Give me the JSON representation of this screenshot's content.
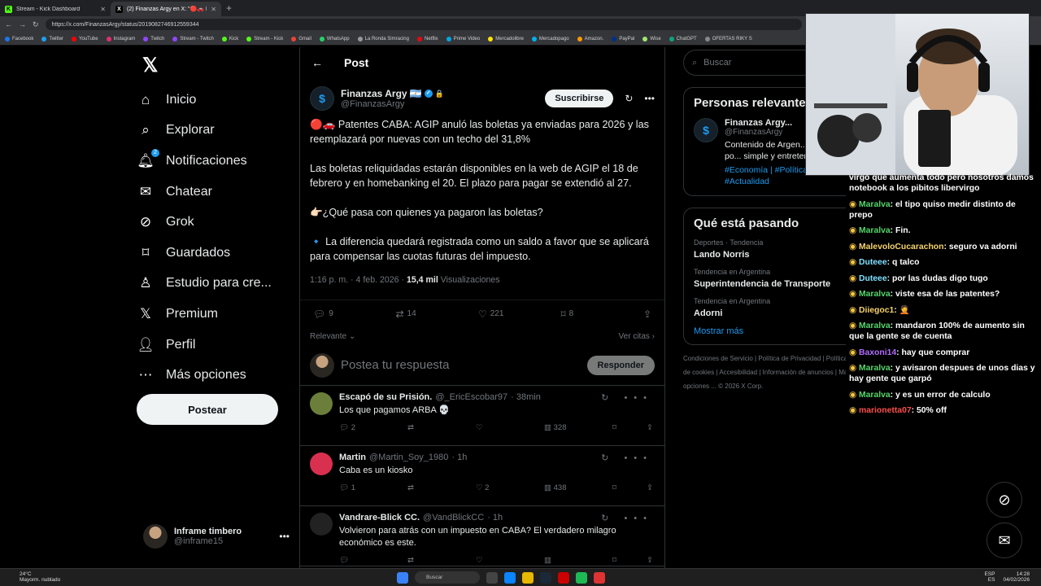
{
  "browser": {
    "tabs": [
      {
        "title": "Stream - Kick Dashboard",
        "icon": "K"
      },
      {
        "title": "(2) Finanzas Argy en X: \"🔴🚗 Pa...",
        "icon": "X"
      }
    ],
    "url": "https://x.com/FinanzasArgy/status/2019082746912559344",
    "bookmarks": [
      "Facebook",
      "Twitter",
      "YouTube",
      "Instagram",
      "Twitch",
      "Stream - Twitch",
      "Kick",
      "Stream - Kick",
      "Gmail",
      "WhatsApp",
      "La Ronda Simracing",
      "Netflix",
      "Prime Video",
      "Mercadolibre",
      "Mercadopago",
      "Amazon.",
      "PayPal",
      "Wise",
      "ChatGPT",
      "OFERTAS RIKY S"
    ]
  },
  "sidebar": {
    "items": [
      {
        "label": "Inicio",
        "icon": "home-icon"
      },
      {
        "label": "Explorar",
        "icon": "search-icon"
      },
      {
        "label": "Notificaciones",
        "icon": "bell-icon",
        "badge": "2"
      },
      {
        "label": "Chatear",
        "icon": "mail-icon"
      },
      {
        "label": "Grok",
        "icon": "grok-icon"
      },
      {
        "label": "Guardados",
        "icon": "bookmark-icon"
      },
      {
        "label": "Estudio para cre...",
        "icon": "creator-icon"
      },
      {
        "label": "Premium",
        "icon": "x-icon"
      },
      {
        "label": "Perfil",
        "icon": "person-icon"
      },
      {
        "label": "Más opciones",
        "icon": "more-icon"
      }
    ],
    "post_button": "Postear",
    "user": {
      "name": "Inframe timbero",
      "handle": "@inframe15"
    }
  },
  "post": {
    "header": "Post",
    "author": {
      "name": "Finanzas Argy 🇦🇷",
      "handle": "@FinanzasArgy"
    },
    "subscribe": "Suscribirse",
    "paragraphs": [
      "🔴🚗 Patentes CABA: AGIP anuló las boletas ya enviadas para 2026 y las reemplazará por nuevas con un techo del 31,8%",
      "Las boletas reliquidadas estarán disponibles en la web de AGIP el 18 de febrero y en homebanking el 20. El plazo para pagar se extendió al 27.",
      "👉🏻¿Qué pasa con quienes ya pagaron las boletas?",
      "🔹 La diferencia quedará registrada como un saldo a favor que se aplicará para compensar las cuotas futuras del impuesto."
    ],
    "time": "1:16 p. m. · 4 feb. 2026 · ",
    "views_count": "15,4 mil",
    "views_label": " Visualizaciones",
    "stats": {
      "replies": "9",
      "reposts": "14",
      "likes": "221",
      "bookmarks": "8"
    },
    "sort": "Relevante",
    "quotes": "Ver citas",
    "reply_placeholder": "Postea tu respuesta",
    "reply_button": "Responder"
  },
  "replies": [
    {
      "name": "Escapó de su Prisión.",
      "handle": "@_EricEscobar97",
      "time": "· 38min",
      "text": "Los que pagamos ARBA 💀",
      "replies": "2",
      "reposts": "",
      "likes": "",
      "views": "328"
    },
    {
      "name": "Martin",
      "handle": "@Martin_Soy_1980",
      "time": "· 1h",
      "text": "Caba es un kiosko",
      "replies": "1",
      "reposts": "",
      "likes": "2",
      "views": "438"
    },
    {
      "name": "Vandrare-Blick CC.",
      "handle": "@VandBlickCC",
      "time": "· 1h",
      "text": "Volvieron para atrás con un impuesto en CABA? El verdadero milagro económico es este.",
      "replies": "",
      "reposts": "",
      "likes": "",
      "views": ""
    }
  ],
  "right": {
    "search": "Buscar",
    "relevant_title": "Personas relevantes",
    "relevant": {
      "name": "Finanzas Argy...",
      "handle": "@FinanzasArgy",
      "desc": "Contenido de Argen... un solo lugar, en po... simple y entretenido.",
      "tags": "#Economía | #Política | #Finanzas | #Actualidad"
    },
    "trending_title": "Qué está pasando",
    "trends": [
      {
        "context": "Deportes · Tendencia",
        "name": "Lando Norris"
      },
      {
        "context": "Tendencia en Argentina",
        "name": "Superintendencia de Transporte"
      },
      {
        "context": "Tendencia en Argentina",
        "name": "Adorni"
      }
    ],
    "show_more": "Mostrar más",
    "footer": "Condiciones de Servicio  |  Política de Privacidad  |  Política de cookies  |  Accesibilidad  |  Información de anuncios  |  Más opciones ...  © 2026 X Corp."
  },
  "chat": [
    {
      "user": "",
      "msg": "virgo que aumenta todo pero nosotros damos notebook a los pibitos libervirgo",
      "color": "#ffffff"
    },
    {
      "user": "Maralva",
      "msg": ": el tipo quiso medir distinto de prepo",
      "color": "#53d769"
    },
    {
      "user": "Maralva",
      "msg": ": Fin.",
      "color": "#53d769"
    },
    {
      "user": "MalevoloCucarachon",
      "msg": ": seguro va adorni",
      "color": "#f6d36b"
    },
    {
      "user": "Duteee",
      "msg": ": q talco",
      "color": "#7ee0ff"
    },
    {
      "user": "Duteee",
      "msg": ": por las dudas digo tugo",
      "color": "#7ee0ff"
    },
    {
      "user": "Maralva",
      "msg": ": viste esa de las patentes?",
      "color": "#53d769"
    },
    {
      "user": "Diiegoc1",
      "msg": ": 🤦",
      "color": "#f6d36b"
    },
    {
      "user": "Maralva",
      "msg": ": mandaron 100% de aumento sin que la gente se de cuenta",
      "color": "#53d769"
    },
    {
      "user": "Baxoni14",
      "msg": ": hay que comprar",
      "color": "#b36bff"
    },
    {
      "user": "Maralva",
      "msg": ": y avisaron despues de unos dias y hay gente que garpó",
      "color": "#53d769"
    },
    {
      "user": "Maralva",
      "msg": ": y es un error de calculo",
      "color": "#53d769"
    },
    {
      "user": "marionetta07",
      "msg": ": 50% off",
      "color": "#ff4d4d"
    }
  ],
  "taskbar": {
    "weather_temp": "24°C",
    "weather_desc": "Mayorm. nublado",
    "search": "Buscar",
    "lang1": "ESP",
    "lang2": "ES",
    "time": "14:28",
    "date": "04/02/2026"
  }
}
